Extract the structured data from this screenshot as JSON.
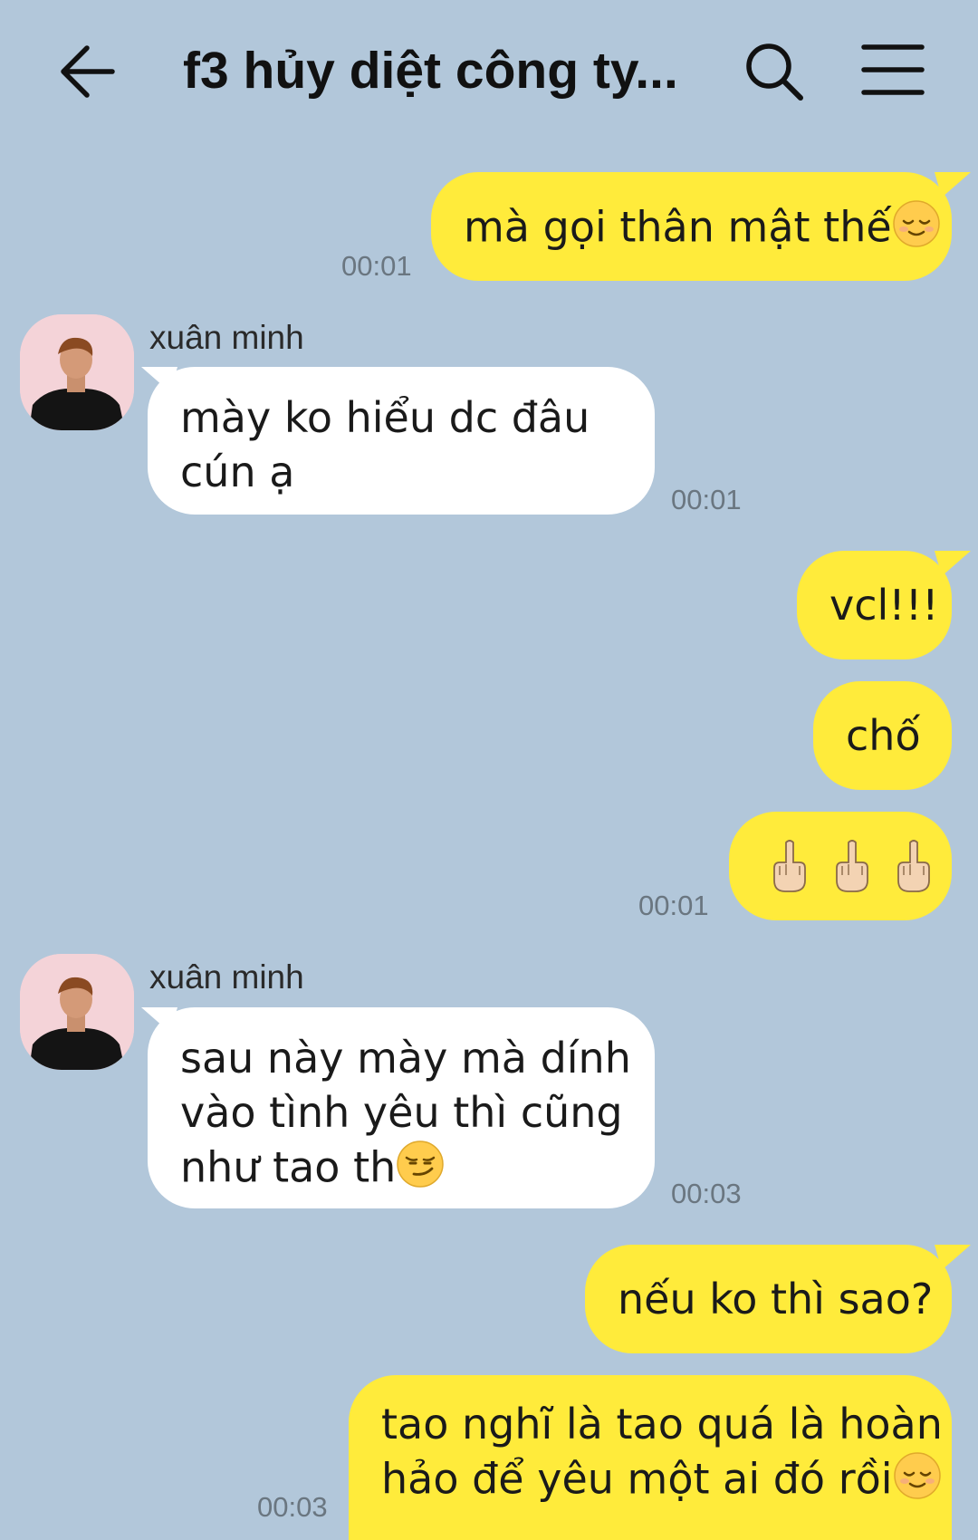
{
  "header": {
    "title": "f3 hủy diệt công ty...",
    "back_icon": "arrow-left-icon",
    "search_icon": "search-icon",
    "menu_icon": "hamburger-menu-icon"
  },
  "colors": {
    "background": "#b2c7da",
    "outgoing_bubble": "#ffeb3b",
    "incoming_bubble": "#ffffff"
  },
  "messages": [
    {
      "direction": "out",
      "text": "mà gọi thân mật thế",
      "emoji": "relieved-face-emoji",
      "time": "00:01"
    },
    {
      "direction": "in",
      "sender": "xuân minh",
      "lines": [
        "mày ko hiểu dc đâu",
        "cún ạ"
      ],
      "time": "00:01"
    },
    {
      "direction": "out",
      "text": "vcl!!!"
    },
    {
      "direction": "out",
      "text": "chố"
    },
    {
      "direction": "out",
      "emoji": "middle-finger-emoji",
      "emoji_count": 3,
      "time": "00:01"
    },
    {
      "direction": "in",
      "sender": "xuân minh",
      "lines": [
        "sau này mày mà dính",
        "vào tình yêu thì cũng",
        "như tao th"
      ],
      "emoji": "smirking-face-emoji",
      "time": "00:03"
    },
    {
      "direction": "out",
      "text": "nếu ko thì sao?"
    },
    {
      "direction": "out",
      "lines": [
        "tao nghĩ là tao quá là hoàn",
        "hảo để yêu một ai đó rồi"
      ],
      "emoji": "relieved-face-emoji",
      "time": "00:03"
    }
  ]
}
